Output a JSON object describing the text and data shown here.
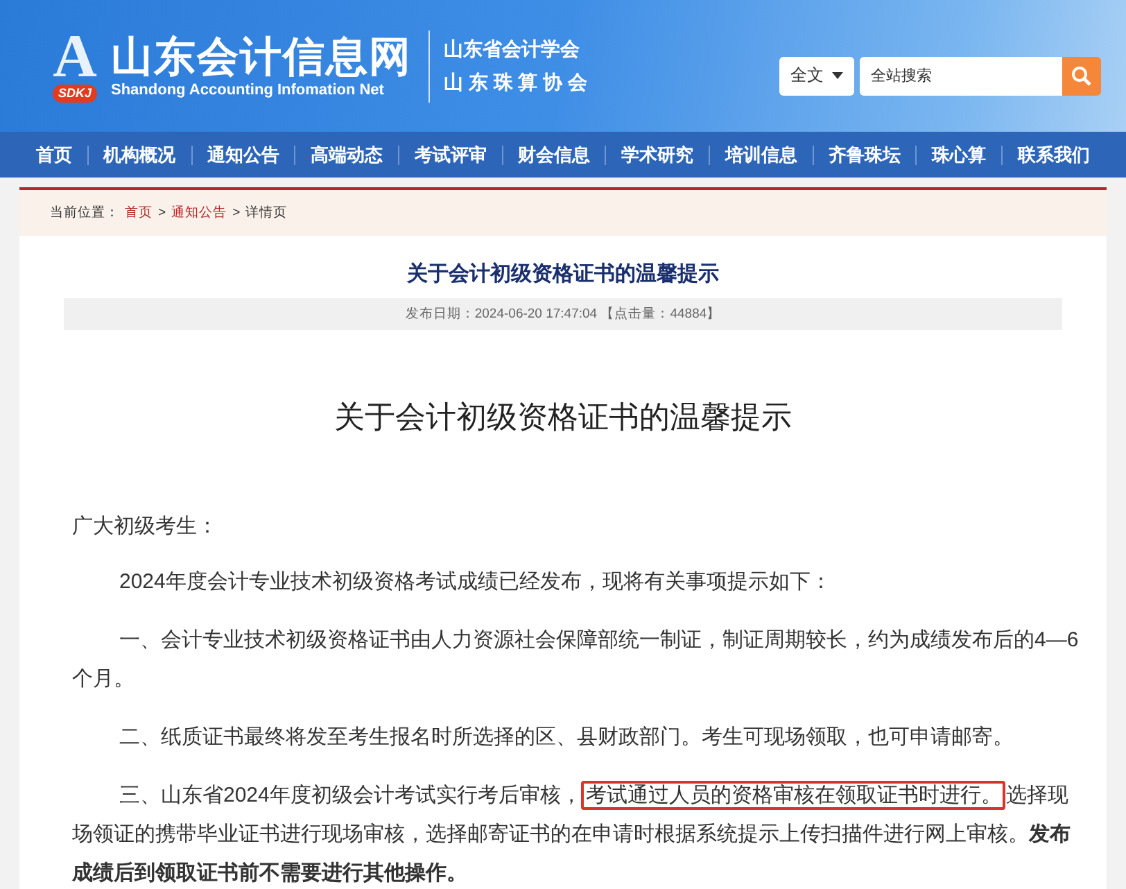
{
  "header": {
    "logo": {
      "letter": "A",
      "badge": "SDKJ",
      "title": "山东会计信息网",
      "subtitle": "Shandong Accounting Infomation Net"
    },
    "societies": [
      "山东省会计学会",
      "山 东 珠 算 协 会"
    ],
    "search": {
      "scope": "全文",
      "placeholder": "全站搜索"
    }
  },
  "nav": [
    "首页",
    "机构概况",
    "通知公告",
    "高端动态",
    "考试评审",
    "财会信息",
    "学术研究",
    "培训信息",
    "齐鲁珠坛",
    "珠心算",
    "联系我们"
  ],
  "breadcrumb": {
    "label": "当前位置：",
    "links": [
      "首页",
      "通知公告"
    ],
    "current": "详情页",
    "separator": ">"
  },
  "article": {
    "title": "关于会计初级资格证书的温馨提示",
    "meta": "发布日期：2024-06-20 17:47:04 【点击量：44884】",
    "heading": "关于会计初级资格证书的温馨提示",
    "paragraphs": [
      {
        "kind": "greeting",
        "segments": [
          {
            "kind": "plain",
            "text": "广大初级考生："
          }
        ]
      },
      {
        "kind": "indented",
        "segments": [
          {
            "kind": "plain",
            "text": "2024年度会计专业技术初级资格考试成绩已经发布，现将有关事项提示如下："
          }
        ]
      },
      {
        "kind": "indented",
        "segments": [
          {
            "kind": "plain",
            "text": "一、会计专业技术初级资格证书由人力资源社会保障部统一制证，制证周期较长，约为成绩发布后的4—6个月。"
          }
        ]
      },
      {
        "kind": "indented",
        "segments": [
          {
            "kind": "plain",
            "text": "二、纸质证书最终将发至考生报名时所选择的区、县财政部门。考生可现场领取，也可申请邮寄。"
          }
        ]
      },
      {
        "kind": "indented",
        "segments": [
          {
            "kind": "plain",
            "text": "三、山东省2024年度初级会计考试实行考后审核，"
          },
          {
            "kind": "boxed",
            "text": "考试通过人员的资格审核在领取证书时进行。"
          },
          {
            "kind": "plain",
            "text": "选择现场领证的携带毕业证书进行现场审核，选择邮寄证书的在申请时根据系统提示上传扫描件进行网上审核。"
          },
          {
            "kind": "bold",
            "text": "发布成绩后到领取证书前不需要进行其他操作。"
          }
        ]
      }
    ]
  }
}
